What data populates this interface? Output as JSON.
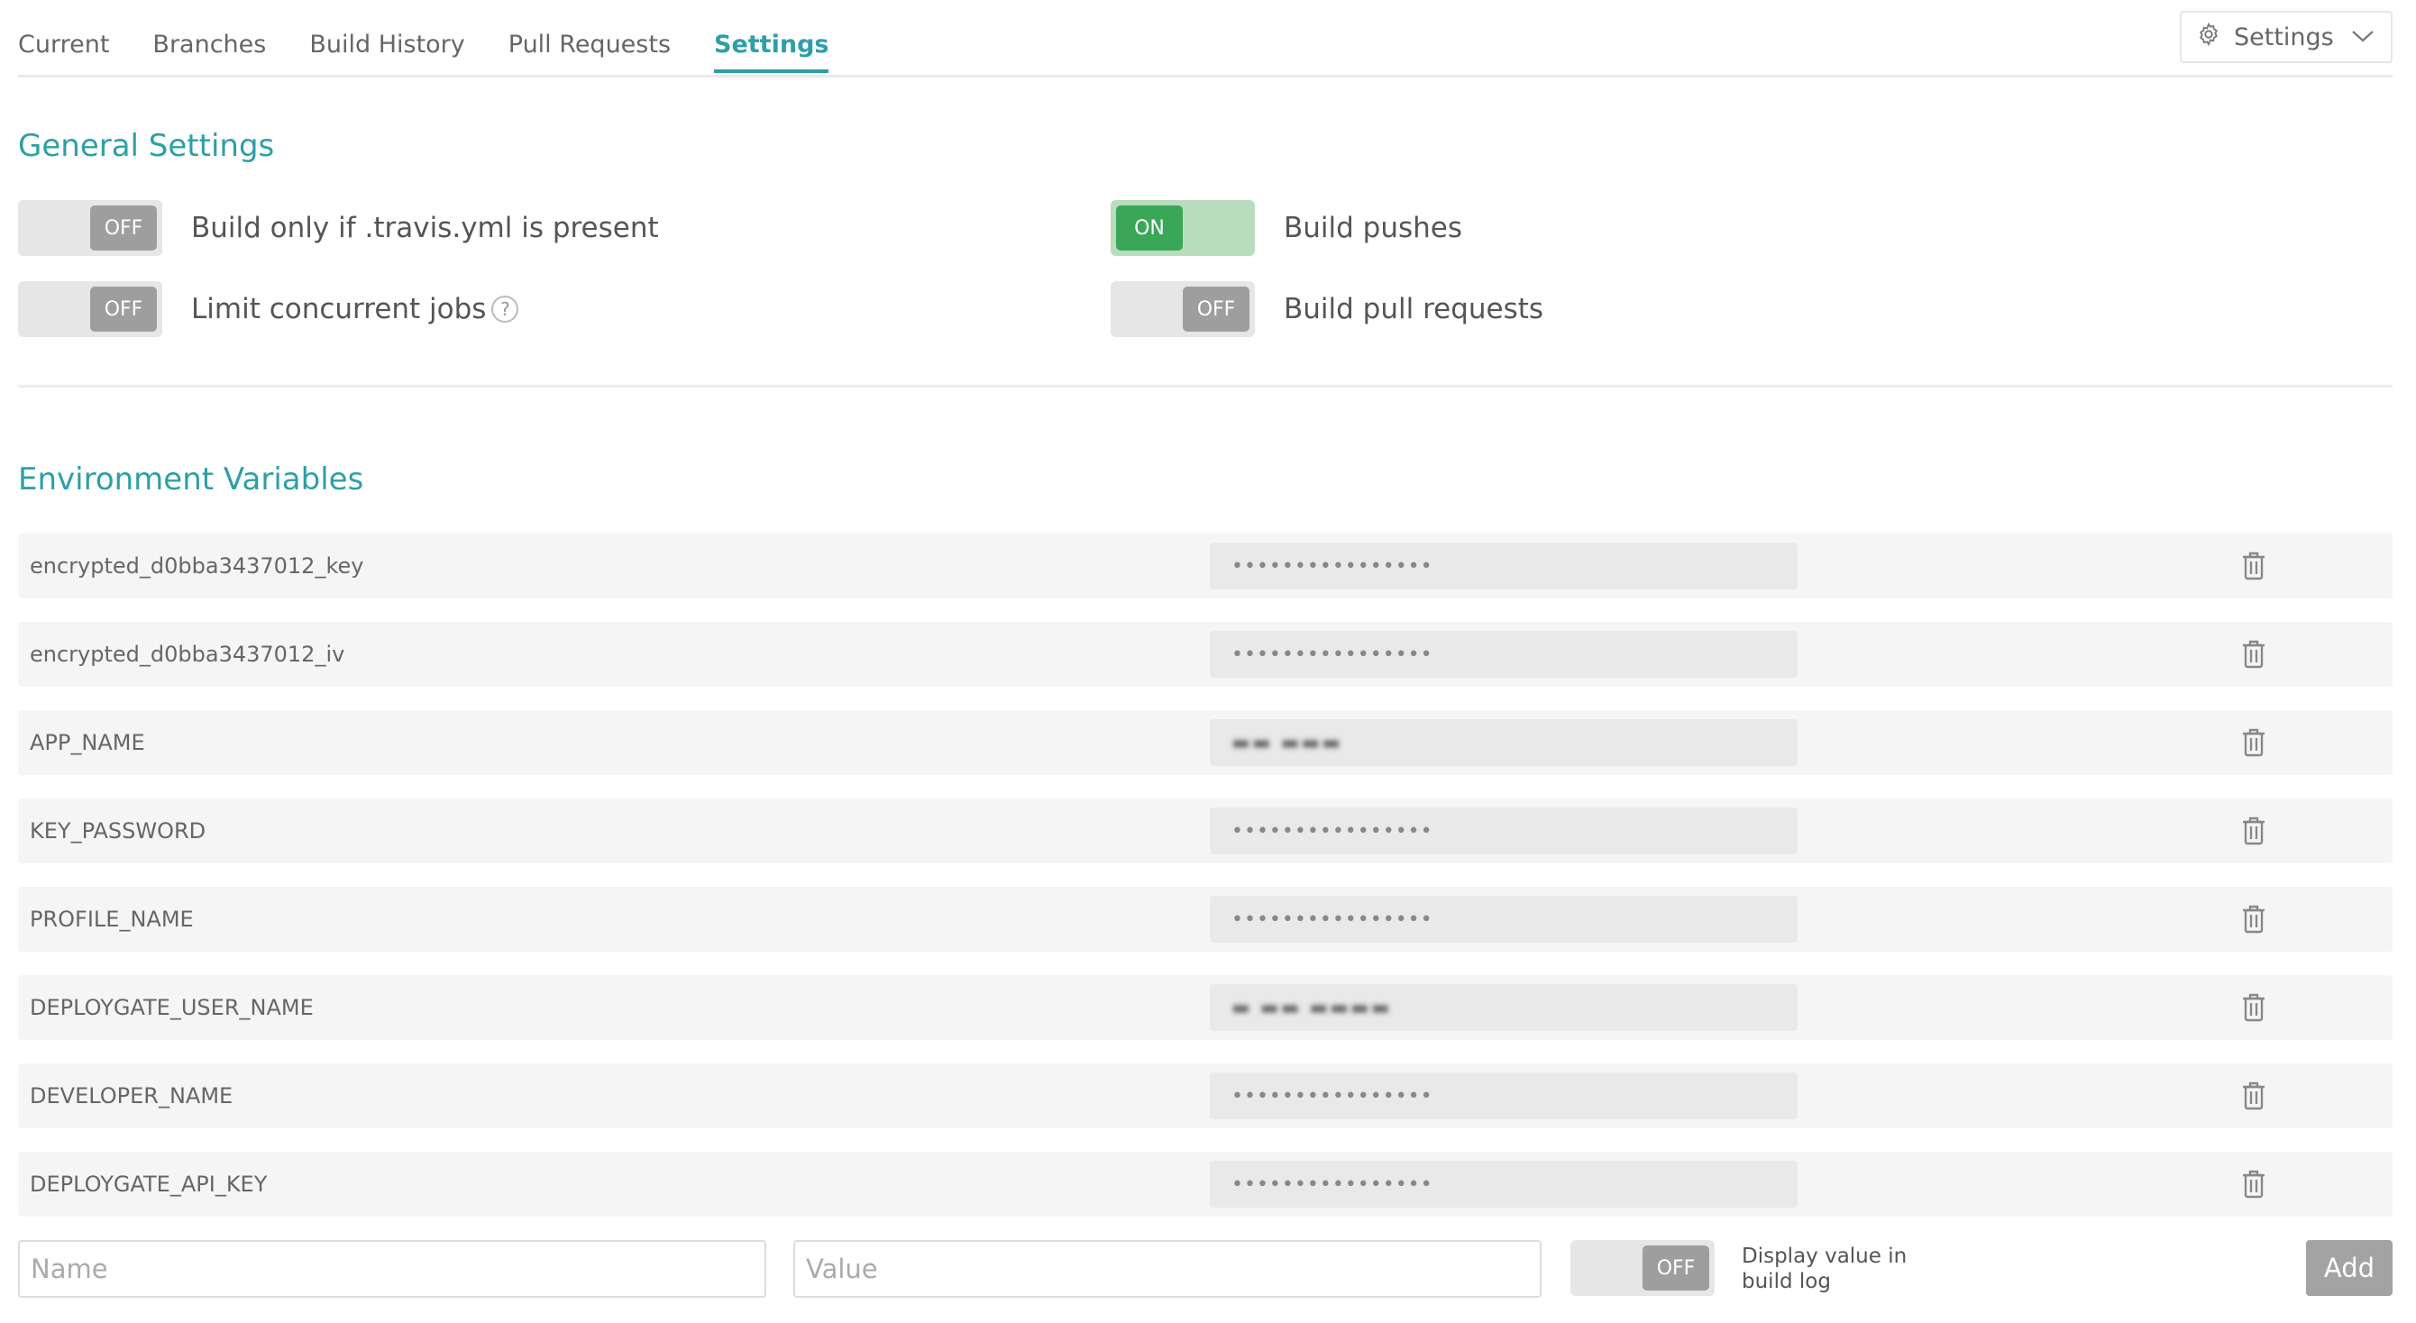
{
  "nav": {
    "tabs": [
      {
        "label": "Current"
      },
      {
        "label": "Branches"
      },
      {
        "label": "Build History"
      },
      {
        "label": "Pull Requests"
      },
      {
        "label": "Settings",
        "active": true
      }
    ],
    "settings_menu": {
      "label": "Settings"
    }
  },
  "general": {
    "title": "General Settings",
    "settings": [
      {
        "label": "Build only if .travis.yml is present",
        "state": "OFF"
      },
      {
        "label": "Build pushes",
        "state": "ON"
      },
      {
        "label": "Limit concurrent jobs",
        "state": "OFF",
        "help": "?"
      },
      {
        "label": "Build pull requests",
        "state": "OFF"
      }
    ]
  },
  "env": {
    "title": "Environment Variables",
    "variables": [
      {
        "name": "encrypted_d0bba3437012_key",
        "value": "••••••••••••••••"
      },
      {
        "name": "encrypted_d0bba3437012_iv",
        "value": "••••••••••••••••"
      },
      {
        "name": "APP_NAME",
        "value": "▬▬ ▬▬▬"
      },
      {
        "name": "KEY_PASSWORD",
        "value": "••••••••••••••••"
      },
      {
        "name": "PROFILE_NAME",
        "value": "••••••••••••••••"
      },
      {
        "name": "DEPLOYGATE_USER_NAME",
        "value": "▬ ▬▬ ▬▬▬▬"
      },
      {
        "name": "DEVELOPER_NAME",
        "value": "••••••••••••••••"
      },
      {
        "name": "DEPLOYGATE_API_KEY",
        "value": "••••••••••••••••"
      }
    ],
    "form": {
      "name_placeholder": "Name",
      "value_placeholder": "Value",
      "display_toggle_state": "OFF",
      "display_label": "Display value in build log",
      "add_label": "Add"
    }
  },
  "colors": {
    "accent": "#2e9fa6",
    "toggle_on": "#3aa657",
    "toggle_off": "#9e9e9e"
  }
}
